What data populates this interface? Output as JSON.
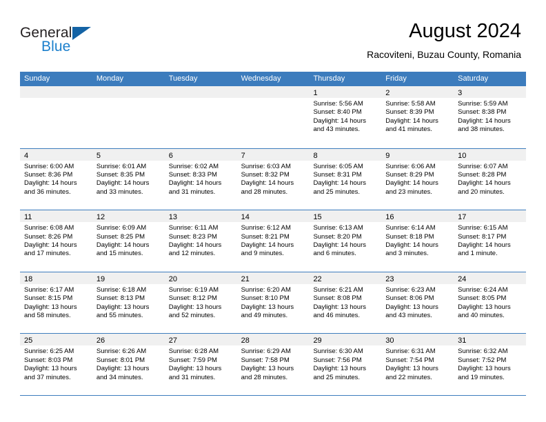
{
  "brand": {
    "name_top": "General",
    "name_bottom": "Blue",
    "triangle_icon": "triangle-icon",
    "colors": {
      "black": "#231f20",
      "blue": "#1b7fcc",
      "triangle": "#1463a5"
    }
  },
  "header": {
    "title": "August 2024",
    "subtitle": "Racoviteni, Buzau County, Romania"
  },
  "colors": {
    "header_row": "#3c7cbd",
    "day_band": "#f0f0f0",
    "grid_line": "#3c7cbd",
    "text": "#000000"
  },
  "weekdays": [
    "Sunday",
    "Monday",
    "Tuesday",
    "Wednesday",
    "Thursday",
    "Friday",
    "Saturday"
  ],
  "weeks": [
    [
      {
        "day": "",
        "lines": []
      },
      {
        "day": "",
        "lines": []
      },
      {
        "day": "",
        "lines": []
      },
      {
        "day": "",
        "lines": []
      },
      {
        "day": "1",
        "lines": [
          "Sunrise: 5:56 AM",
          "Sunset: 8:40 PM",
          "Daylight: 14 hours",
          "and 43 minutes."
        ]
      },
      {
        "day": "2",
        "lines": [
          "Sunrise: 5:58 AM",
          "Sunset: 8:39 PM",
          "Daylight: 14 hours",
          "and 41 minutes."
        ]
      },
      {
        "day": "3",
        "lines": [
          "Sunrise: 5:59 AM",
          "Sunset: 8:38 PM",
          "Daylight: 14 hours",
          "and 38 minutes."
        ]
      }
    ],
    [
      {
        "day": "4",
        "lines": [
          "Sunrise: 6:00 AM",
          "Sunset: 8:36 PM",
          "Daylight: 14 hours",
          "and 36 minutes."
        ]
      },
      {
        "day": "5",
        "lines": [
          "Sunrise: 6:01 AM",
          "Sunset: 8:35 PM",
          "Daylight: 14 hours",
          "and 33 minutes."
        ]
      },
      {
        "day": "6",
        "lines": [
          "Sunrise: 6:02 AM",
          "Sunset: 8:33 PM",
          "Daylight: 14 hours",
          "and 31 minutes."
        ]
      },
      {
        "day": "7",
        "lines": [
          "Sunrise: 6:03 AM",
          "Sunset: 8:32 PM",
          "Daylight: 14 hours",
          "and 28 minutes."
        ]
      },
      {
        "day": "8",
        "lines": [
          "Sunrise: 6:05 AM",
          "Sunset: 8:31 PM",
          "Daylight: 14 hours",
          "and 25 minutes."
        ]
      },
      {
        "day": "9",
        "lines": [
          "Sunrise: 6:06 AM",
          "Sunset: 8:29 PM",
          "Daylight: 14 hours",
          "and 23 minutes."
        ]
      },
      {
        "day": "10",
        "lines": [
          "Sunrise: 6:07 AM",
          "Sunset: 8:28 PM",
          "Daylight: 14 hours",
          "and 20 minutes."
        ]
      }
    ],
    [
      {
        "day": "11",
        "lines": [
          "Sunrise: 6:08 AM",
          "Sunset: 8:26 PM",
          "Daylight: 14 hours",
          "and 17 minutes."
        ]
      },
      {
        "day": "12",
        "lines": [
          "Sunrise: 6:09 AM",
          "Sunset: 8:25 PM",
          "Daylight: 14 hours",
          "and 15 minutes."
        ]
      },
      {
        "day": "13",
        "lines": [
          "Sunrise: 6:11 AM",
          "Sunset: 8:23 PM",
          "Daylight: 14 hours",
          "and 12 minutes."
        ]
      },
      {
        "day": "14",
        "lines": [
          "Sunrise: 6:12 AM",
          "Sunset: 8:21 PM",
          "Daylight: 14 hours",
          "and 9 minutes."
        ]
      },
      {
        "day": "15",
        "lines": [
          "Sunrise: 6:13 AM",
          "Sunset: 8:20 PM",
          "Daylight: 14 hours",
          "and 6 minutes."
        ]
      },
      {
        "day": "16",
        "lines": [
          "Sunrise: 6:14 AM",
          "Sunset: 8:18 PM",
          "Daylight: 14 hours",
          "and 3 minutes."
        ]
      },
      {
        "day": "17",
        "lines": [
          "Sunrise: 6:15 AM",
          "Sunset: 8:17 PM",
          "Daylight: 14 hours",
          "and 1 minute."
        ]
      }
    ],
    [
      {
        "day": "18",
        "lines": [
          "Sunrise: 6:17 AM",
          "Sunset: 8:15 PM",
          "Daylight: 13 hours",
          "and 58 minutes."
        ]
      },
      {
        "day": "19",
        "lines": [
          "Sunrise: 6:18 AM",
          "Sunset: 8:13 PM",
          "Daylight: 13 hours",
          "and 55 minutes."
        ]
      },
      {
        "day": "20",
        "lines": [
          "Sunrise: 6:19 AM",
          "Sunset: 8:12 PM",
          "Daylight: 13 hours",
          "and 52 minutes."
        ]
      },
      {
        "day": "21",
        "lines": [
          "Sunrise: 6:20 AM",
          "Sunset: 8:10 PM",
          "Daylight: 13 hours",
          "and 49 minutes."
        ]
      },
      {
        "day": "22",
        "lines": [
          "Sunrise: 6:21 AM",
          "Sunset: 8:08 PM",
          "Daylight: 13 hours",
          "and 46 minutes."
        ]
      },
      {
        "day": "23",
        "lines": [
          "Sunrise: 6:23 AM",
          "Sunset: 8:06 PM",
          "Daylight: 13 hours",
          "and 43 minutes."
        ]
      },
      {
        "day": "24",
        "lines": [
          "Sunrise: 6:24 AM",
          "Sunset: 8:05 PM",
          "Daylight: 13 hours",
          "and 40 minutes."
        ]
      }
    ],
    [
      {
        "day": "25",
        "lines": [
          "Sunrise: 6:25 AM",
          "Sunset: 8:03 PM",
          "Daylight: 13 hours",
          "and 37 minutes."
        ]
      },
      {
        "day": "26",
        "lines": [
          "Sunrise: 6:26 AM",
          "Sunset: 8:01 PM",
          "Daylight: 13 hours",
          "and 34 minutes."
        ]
      },
      {
        "day": "27",
        "lines": [
          "Sunrise: 6:28 AM",
          "Sunset: 7:59 PM",
          "Daylight: 13 hours",
          "and 31 minutes."
        ]
      },
      {
        "day": "28",
        "lines": [
          "Sunrise: 6:29 AM",
          "Sunset: 7:58 PM",
          "Daylight: 13 hours",
          "and 28 minutes."
        ]
      },
      {
        "day": "29",
        "lines": [
          "Sunrise: 6:30 AM",
          "Sunset: 7:56 PM",
          "Daylight: 13 hours",
          "and 25 minutes."
        ]
      },
      {
        "day": "30",
        "lines": [
          "Sunrise: 6:31 AM",
          "Sunset: 7:54 PM",
          "Daylight: 13 hours",
          "and 22 minutes."
        ]
      },
      {
        "day": "31",
        "lines": [
          "Sunrise: 6:32 AM",
          "Sunset: 7:52 PM",
          "Daylight: 13 hours",
          "and 19 minutes."
        ]
      }
    ]
  ]
}
